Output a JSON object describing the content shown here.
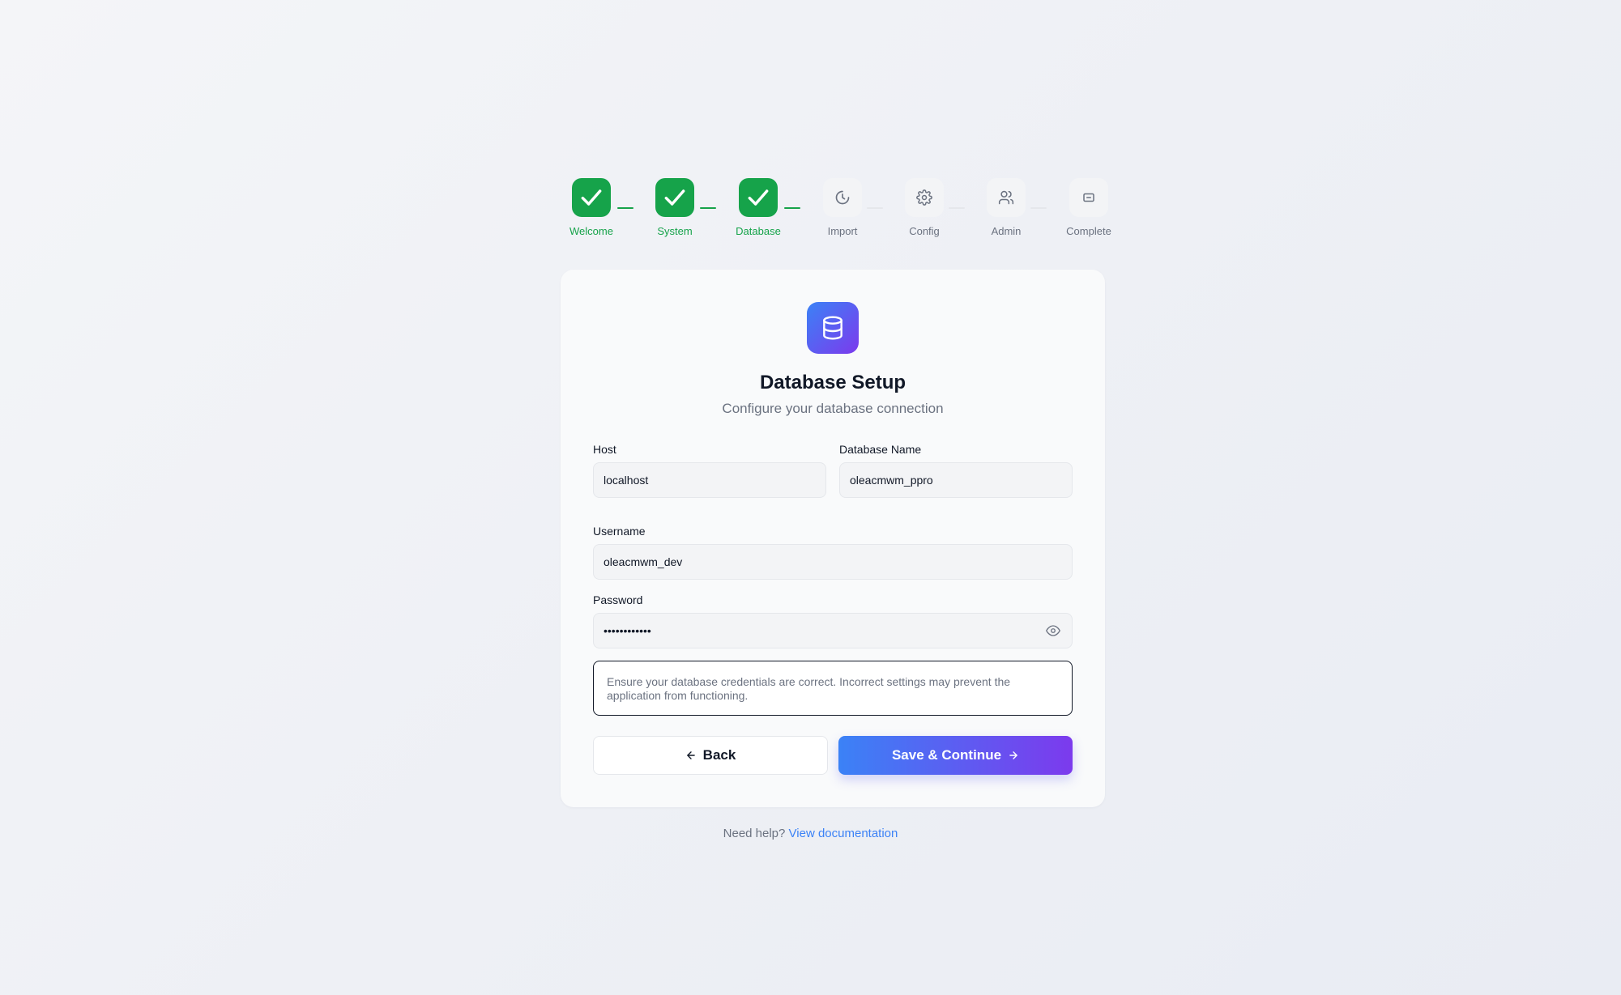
{
  "stepper": {
    "steps": [
      {
        "label": "Welcome",
        "status": "completed",
        "icon": "check-icon"
      },
      {
        "label": "System",
        "status": "completed",
        "icon": "check-icon"
      },
      {
        "label": "Database",
        "status": "completed",
        "icon": "check-icon"
      },
      {
        "label": "Import",
        "status": "pending",
        "icon": "clock-icon"
      },
      {
        "label": "Config",
        "status": "pending",
        "icon": "gear-icon"
      },
      {
        "label": "Admin",
        "status": "pending",
        "icon": "users-icon"
      },
      {
        "label": "Complete",
        "status": "pending",
        "icon": "flag-icon"
      }
    ]
  },
  "card": {
    "icon": "database-icon",
    "title": "Database Setup",
    "subtitle": "Configure your database connection"
  },
  "form": {
    "host": {
      "label": "Host",
      "value": "localhost"
    },
    "database_name": {
      "label": "Database Name",
      "value": "oleacmwm_ppro"
    },
    "username": {
      "label": "Username",
      "value": "oleacmwm_dev"
    },
    "password": {
      "label": "Password",
      "value": "••••••••••••",
      "toggle_icon": "eye-icon"
    }
  },
  "notice": "Ensure your database credentials are correct. Incorrect settings may prevent the application from functioning.",
  "buttons": {
    "back_label": "Back",
    "back_icon": "arrow-left-icon",
    "save_label": "Save & Continue",
    "save_icon": "arrow-right-icon"
  },
  "help": {
    "prompt": "Need help?",
    "link_text": "View documentation"
  },
  "colors": {
    "success": "#16a34a",
    "accent_start": "#3b82f6",
    "accent_end": "#7c3aed",
    "muted": "#6b7280"
  }
}
